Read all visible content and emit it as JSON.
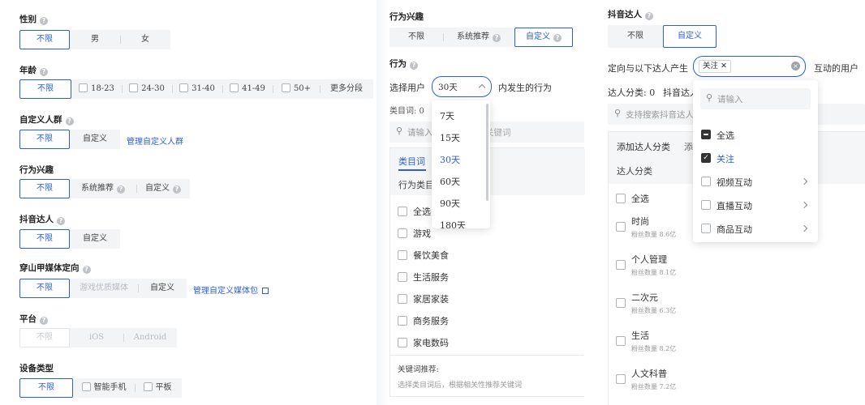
{
  "left": {
    "gender": {
      "label": "性别",
      "options": [
        "不限",
        "男",
        "女"
      ]
    },
    "age": {
      "label": "年龄",
      "options": [
        "不限",
        "18-23",
        "24-30",
        "31-40",
        "41-49",
        "50+"
      ],
      "more": "更多分段"
    },
    "custom_crowd": {
      "label": "自定义人群",
      "options": [
        "不限",
        "自定义"
      ],
      "manage_link": "管理自定义人群"
    },
    "interest": {
      "label": "行为兴趣",
      "options": [
        "不限",
        "系统推荐",
        "自定义"
      ]
    },
    "douyin": {
      "label": "抖音达人",
      "options": [
        "不限",
        "自定义"
      ]
    },
    "media": {
      "label": "穿山甲媒体定向",
      "options": [
        "不限",
        "游戏优质媒体",
        "自定义"
      ],
      "manage_link": "管理自定义媒体包"
    },
    "platform": {
      "label": "平台",
      "options": [
        "不限",
        "iOS",
        "Android"
      ]
    },
    "device": {
      "label": "设备类型",
      "options": [
        "不限",
        "智能手机",
        "平板"
      ]
    }
  },
  "middle": {
    "interest_label": "行为兴趣",
    "interest_options": [
      "不限",
      "系统推荐",
      "自定义"
    ],
    "behavior_label": "行为",
    "select_user": "选择用户",
    "select_value": "30天",
    "behavior_suffix": "内发生的行为",
    "keyword_count": "类目词: 0",
    "search_placeholder": "请输入",
    "search_placeholder_tail": "关键词",
    "tab_category": "类目词",
    "col_header": "行为类目",
    "dropdown_options": [
      "7天",
      "15天",
      "30天",
      "60天",
      "90天",
      "180天"
    ],
    "dropdown_selected": "30天",
    "categories": [
      "全选",
      "游戏",
      "餐饮美食",
      "生活服务",
      "家居家装",
      "商务服务",
      "家电数码"
    ],
    "keyword_rec_title": "关键词推荐:",
    "keyword_rec_desc": "选择类目词后，根据相关性推荐关键词"
  },
  "right": {
    "title": "抖音达人",
    "options": [
      "不限",
      "自定义"
    ],
    "produce_label": "定向与以下达人产生",
    "tag": "关注",
    "produce_suffix": "互动的用户",
    "count_label": "达人分类: 0",
    "count_tail": "抖音达人",
    "search_placeholder": "支持搜索抖音达人",
    "tab_add": "添加达人分类",
    "tab_add2": "添",
    "col_header": "达人分类",
    "list": [
      {
        "name": "全选",
        "fans": ""
      },
      {
        "name": "时尚",
        "fans": "粉丝数量 8.6亿"
      },
      {
        "name": "个人管理",
        "fans": "粉丝数量 8.1亿"
      },
      {
        "name": "二次元",
        "fans": "粉丝数量 6.3亿"
      },
      {
        "name": "生活",
        "fans": "粉丝数量 8.2亿"
      },
      {
        "name": "人文科普",
        "fans": "粉丝数量 7.2亿"
      }
    ],
    "dropdown_search": "请输入",
    "dropdown_items": [
      "全选",
      "关注",
      "视频互动",
      "直播互动",
      "商品互动"
    ]
  },
  "colors": {
    "accent": "#2b5fd9",
    "border": "#e1e4e8",
    "bg_seg": "#f3f4f5"
  }
}
